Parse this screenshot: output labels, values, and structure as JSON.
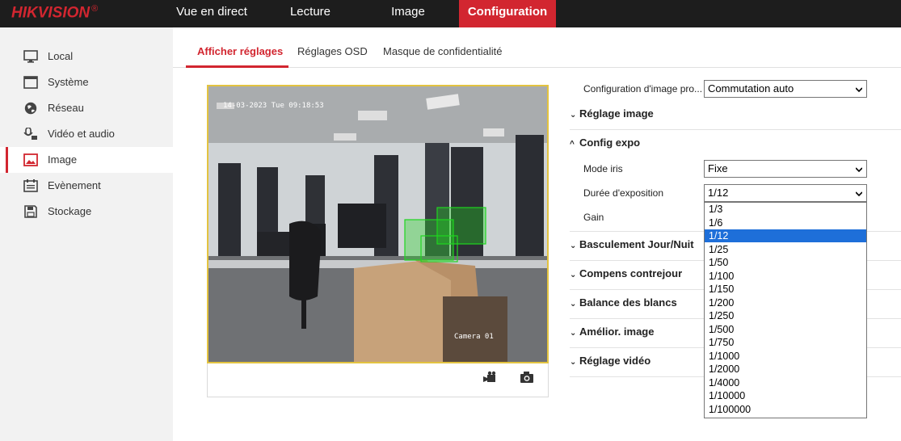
{
  "brand": {
    "name": "HIKVISION",
    "mark": "®"
  },
  "topnav": [
    {
      "label": "Vue en direct"
    },
    {
      "label": "Lecture"
    },
    {
      "label": "Image"
    },
    {
      "label": "Configuration"
    }
  ],
  "sidebar": [
    {
      "label": "Local",
      "icon": "monitor-icon"
    },
    {
      "label": "Système",
      "icon": "system-icon"
    },
    {
      "label": "Réseau",
      "icon": "globe-icon"
    },
    {
      "label": "Vidéo et audio",
      "icon": "mic-camera-icon"
    },
    {
      "label": "Image",
      "icon": "image-icon"
    },
    {
      "label": "Evènement",
      "icon": "calendar-icon"
    },
    {
      "label": "Stockage",
      "icon": "save-icon"
    }
  ],
  "tabs": [
    {
      "label": "Afficher réglages"
    },
    {
      "label": "Réglages OSD"
    },
    {
      "label": "Masque de confidentialité"
    }
  ],
  "video": {
    "osd_date": "14-03-2023 Tue 09:18:53",
    "osd_camera": "Camera 01"
  },
  "settings": {
    "profile_label": "Configuration d'image pro...",
    "profile_value": "Commutation auto",
    "image_section": "Réglage image",
    "expo_section": "Config expo",
    "iris_label": "Mode iris",
    "iris_value": "Fixe",
    "exposure_label": "Durée d'exposition",
    "exposure_value": "1/12",
    "gain_label": "Gain",
    "sections": [
      "Basculement Jour/Nuit",
      "Compens contrejour",
      "Balance des blancs",
      "Amélior. image",
      "Réglage vidéo"
    ]
  },
  "exposure_options": [
    "1/3",
    "1/6",
    "1/12",
    "1/25",
    "1/50",
    "1/100",
    "1/150",
    "1/200",
    "1/250",
    "1/500",
    "1/750",
    "1/1000",
    "1/2000",
    "1/4000",
    "1/10000",
    "1/100000"
  ],
  "colors": {
    "accent": "#d22630",
    "topbar": "#1d1d1d",
    "select_highlight": "#1e6fd9"
  }
}
